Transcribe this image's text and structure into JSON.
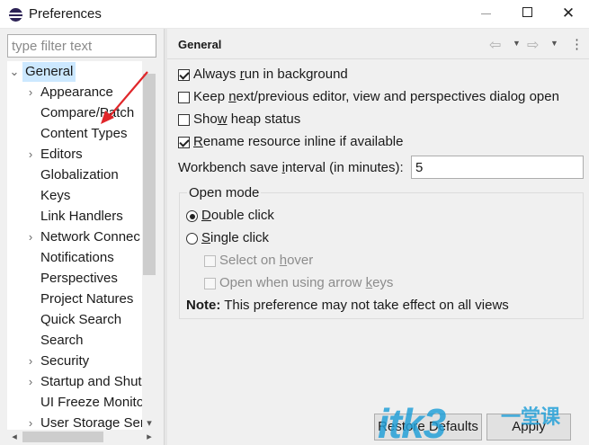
{
  "window": {
    "title": "Preferences",
    "min_label": "",
    "max_label": "",
    "close_label": "✕"
  },
  "filter": {
    "placeholder": "type filter text",
    "value": ""
  },
  "tree": {
    "selected": "General",
    "items": [
      {
        "label": "General",
        "expanded": true,
        "has_children": true,
        "level": 0
      },
      {
        "label": "Appearance",
        "has_children": true,
        "level": 1
      },
      {
        "label": "Compare/Patch",
        "has_children": false,
        "level": 1
      },
      {
        "label": "Content Types",
        "has_children": false,
        "level": 1
      },
      {
        "label": "Editors",
        "has_children": true,
        "level": 1
      },
      {
        "label": "Globalization",
        "has_children": false,
        "level": 1
      },
      {
        "label": "Keys",
        "has_children": false,
        "level": 1
      },
      {
        "label": "Link Handlers",
        "has_children": false,
        "level": 1
      },
      {
        "label": "Network Connec",
        "has_children": true,
        "level": 1
      },
      {
        "label": "Notifications",
        "has_children": false,
        "level": 1
      },
      {
        "label": "Perspectives",
        "has_children": false,
        "level": 1
      },
      {
        "label": "Project Natures",
        "has_children": false,
        "level": 1
      },
      {
        "label": "Quick Search",
        "has_children": false,
        "level": 1
      },
      {
        "label": "Search",
        "has_children": false,
        "level": 1
      },
      {
        "label": "Security",
        "has_children": true,
        "level": 1
      },
      {
        "label": "Startup and Shut",
        "has_children": true,
        "level": 1
      },
      {
        "label": "UI Freeze Monito",
        "has_children": false,
        "level": 1
      },
      {
        "label": "User Storage Ser",
        "has_children": true,
        "level": 1
      }
    ]
  },
  "page": {
    "title": "General",
    "options": {
      "always_run": {
        "before": "Always ",
        "mnemonic": "r",
        "after": "un in background",
        "checked": true
      },
      "keep_next": {
        "before": "Keep ",
        "mnemonic": "n",
        "after": "ext/previous editor, view and perspectives dialog open",
        "checked": false
      },
      "show_heap": {
        "before": "Sho",
        "mnemonic": "w",
        "after": " heap status",
        "checked": false
      },
      "rename_inline": {
        "before": "",
        "mnemonic": "R",
        "after": "ename resource inline if available",
        "checked": true
      }
    },
    "interval": {
      "before": "Workbench save ",
      "mnemonic": "i",
      "after": "nterval (in minutes):",
      "value": "5"
    },
    "open_mode": {
      "title": "Open mode",
      "double_click": {
        "before": "",
        "mnemonic": "D",
        "after": "ouble click",
        "selected": true
      },
      "single_click": {
        "before": "",
        "mnemonic": "S",
        "after": "ingle click",
        "selected": false
      },
      "select_on_hover": {
        "before": "Select on ",
        "mnemonic": "h",
        "after": "over",
        "checked": false,
        "enabled": false
      },
      "open_with_arrows": {
        "before": "Open when using arrow ",
        "mnemonic": "k",
        "after": "eys",
        "checked": false,
        "enabled": false
      },
      "note_bold": "Note:",
      "note_text": " This preference may not take effect on all views"
    },
    "buttons": {
      "restore": "Restore Defaults",
      "apply": "Apply"
    }
  },
  "watermark": {
    "text": "itk3",
    "cn": "一堂课"
  },
  "colors": {
    "selection": "#cce8ff",
    "accent_arrow": "#e0262a",
    "watermark": "#1f9fd8"
  }
}
